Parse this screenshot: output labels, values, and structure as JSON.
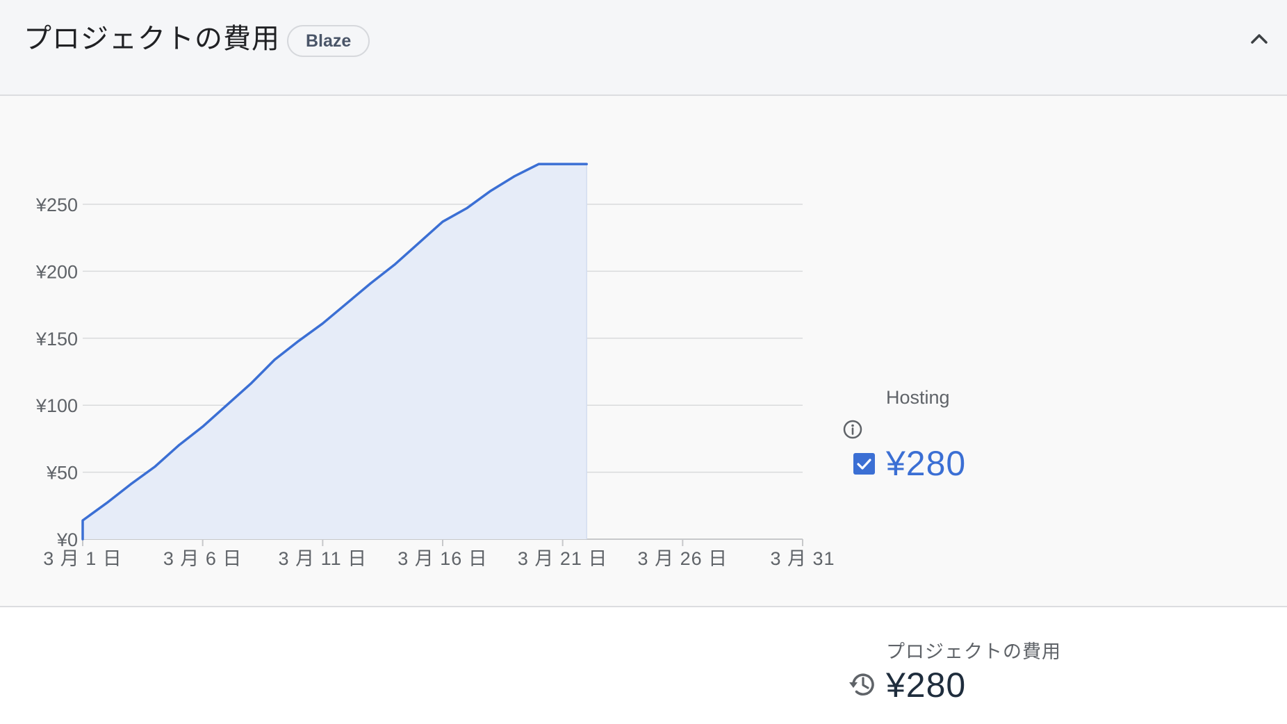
{
  "header": {
    "title": "プロジェクトの費用",
    "plan_badge": "Blaze",
    "collapse_icon": "chevron-up-icon"
  },
  "legend": {
    "series_label": "Hosting",
    "info_icon": "info-icon",
    "checked": true,
    "value": "¥280",
    "color": "#3b6fd4"
  },
  "total": {
    "label": "プロジェクトの費用",
    "icon": "history-icon",
    "value": "¥280"
  },
  "chart_data": {
    "type": "area",
    "x_labels": [
      "3 月 1 日",
      "3 月 6 日",
      "3 月 11 日",
      "3 月 16 日",
      "3 月 21 日",
      "3 月 26 日",
      "3 月 31"
    ],
    "x_label_days": [
      1,
      6,
      11,
      16,
      21,
      26,
      31
    ],
    "y_ticks": [
      "¥0",
      "¥50",
      "¥100",
      "¥150",
      "¥200",
      "¥250"
    ],
    "y_tick_values": [
      0,
      50,
      100,
      150,
      200,
      250
    ],
    "xlim": [
      1,
      31
    ],
    "ylim": [
      0,
      250
    ],
    "grid": true,
    "series": [
      {
        "name": "Hosting",
        "color": "#3b6fd4",
        "fill": "#e6ecf8",
        "x": [
          1,
          1,
          2,
          3,
          4,
          5,
          6,
          7,
          8,
          9,
          10,
          11,
          12,
          13,
          14,
          15,
          16,
          17,
          18,
          19,
          20,
          21,
          22
        ],
        "y": [
          0,
          14,
          27,
          41,
          54,
          70,
          84,
          100,
          116,
          134,
          148,
          161,
          176,
          191,
          205,
          221,
          237,
          247,
          260,
          271,
          280,
          280,
          280
        ]
      }
    ]
  }
}
